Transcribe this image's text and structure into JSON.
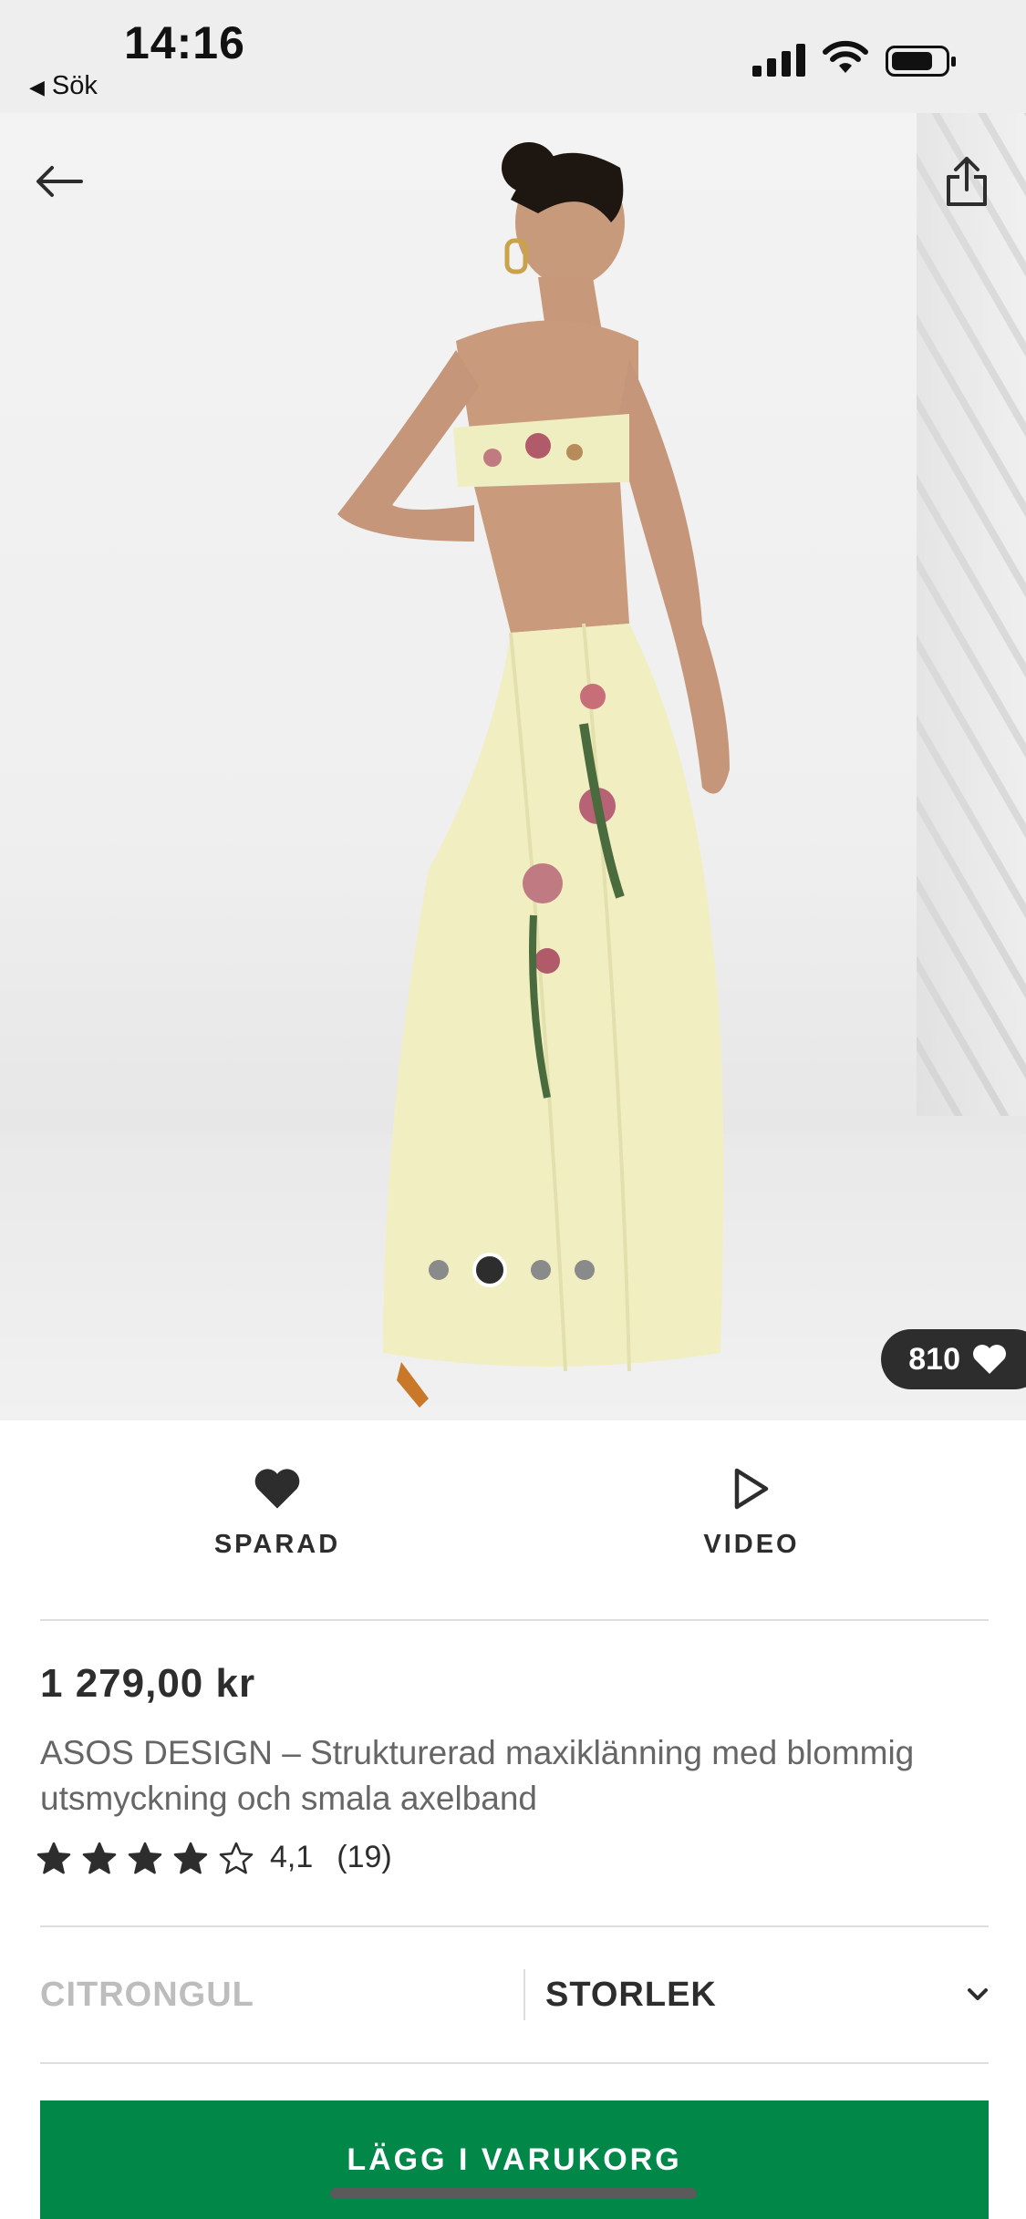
{
  "status_bar": {
    "time": "14:16",
    "back_app_label": "Sök"
  },
  "product": {
    "likes_count": "810",
    "gallery": {
      "image_count": 4,
      "active_index": 1
    },
    "price": "1 279,00 kr",
    "title": "ASOS DESIGN – Strukturerad maxiklänning med blommig utsmyckning och smala axelband",
    "rating": {
      "score": 4.1,
      "score_label": "4,1",
      "reviews_label": "(19)",
      "stars_total": 5
    },
    "color_label": "CITRONGUL",
    "size_label": "STORLEK"
  },
  "actions": {
    "saved_label": "SPARAD",
    "video_label": "VIDEO"
  },
  "cta": {
    "add_to_cart_label": "LÄGG I VARUKORG",
    "color": "#018849"
  },
  "colors": {
    "text_dark": "#2d2d2d",
    "muted": "#bdbdbd",
    "dress": "#f1efc2"
  },
  "icons": [
    "back-arrow-icon",
    "share-icon",
    "heart-icon",
    "play-icon",
    "star-icon",
    "chevron-down-icon"
  ]
}
